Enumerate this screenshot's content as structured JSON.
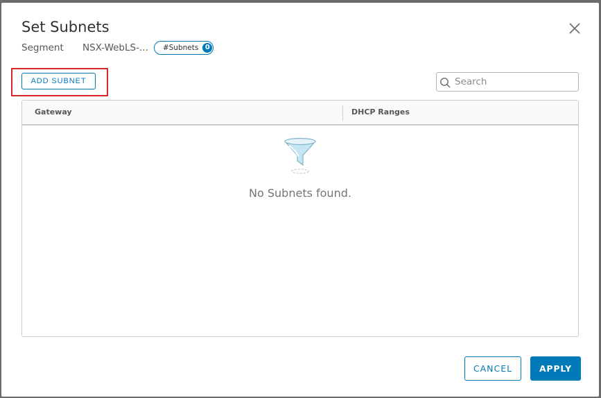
{
  "dialog": {
    "title": "Set Subnets",
    "close_icon": "close-icon"
  },
  "segment": {
    "label": "Segment",
    "value": "NSX-WebLS-...",
    "badge_label": "#Subnets",
    "badge_count": "0"
  },
  "toolbar": {
    "add_subnet_label": "ADD SUBNET"
  },
  "search": {
    "placeholder": "Search",
    "value": "",
    "icon": "search-icon"
  },
  "grid": {
    "columns": [
      "Gateway",
      "DHCP Ranges"
    ],
    "rows": [],
    "empty_icon": "filter-funnel-icon",
    "empty_text": "No Subnets found."
  },
  "footer": {
    "cancel_label": "CANCEL",
    "apply_label": "APPLY"
  },
  "colors": {
    "accent": "#0079b8",
    "highlight": "#d9262a",
    "text": "#313131",
    "muted": "#747474"
  }
}
